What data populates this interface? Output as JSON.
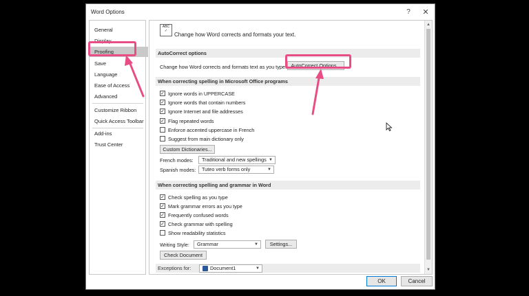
{
  "window": {
    "title": "Word Options",
    "help": "?",
    "close": "✕"
  },
  "sidebar": {
    "items": [
      {
        "label": "General"
      },
      {
        "label": "Display"
      },
      {
        "label": "Proofing"
      },
      {
        "label": "Save"
      },
      {
        "label": "Language"
      },
      {
        "label": "Ease of Access"
      },
      {
        "label": "Advanced"
      },
      {
        "label": "Customize Ribbon"
      },
      {
        "label": "Quick Access Toolbar"
      },
      {
        "label": "Add-ins"
      },
      {
        "label": "Trust Center"
      }
    ]
  },
  "header": {
    "text": "Change how Word corrects and formats your text.",
    "icon": "abc-spellcheck-icon",
    "icon_text": "ABC"
  },
  "autocorrect": {
    "section_title": "AutoCorrect options",
    "desc": "Change how Word corrects and formats text as you type:",
    "button": "AutoCorrect Options..."
  },
  "office_spelling": {
    "section_title": "When correcting spelling in Microsoft Office programs",
    "options": [
      {
        "label": "Ignore words in UPPERCASE",
        "checked": true
      },
      {
        "label": "Ignore words that contain numbers",
        "checked": true
      },
      {
        "label": "Ignore Internet and file addresses",
        "checked": true
      },
      {
        "label": "Flag repeated words",
        "checked": true
      },
      {
        "label": "Enforce accented uppercase in French",
        "checked": false
      },
      {
        "label": "Suggest from main dictionary only",
        "checked": false
      }
    ],
    "dictionaries_button": "Custom Dictionaries...",
    "french_label": "French modes:",
    "french_value": "Traditional and new spellings",
    "spanish_label": "Spanish modes:",
    "spanish_value": "Tuteo verb forms only"
  },
  "word_spelling": {
    "section_title": "When correcting spelling and grammar in Word",
    "options": [
      {
        "label": "Check spelling as you type",
        "checked": true
      },
      {
        "label": "Mark grammar errors as you type",
        "checked": true
      },
      {
        "label": "Frequently confused words",
        "checked": true
      },
      {
        "label": "Check grammar with spelling",
        "checked": true
      },
      {
        "label": "Show readability statistics",
        "checked": false
      }
    ],
    "writing_style_label": "Writing Style:",
    "writing_style_value": "Grammar",
    "settings_button": "Settings...",
    "check_document_button": "Check Document"
  },
  "exceptions": {
    "label": "Exceptions for:",
    "value": "Document1"
  },
  "footer": {
    "ok": "OK",
    "cancel": "Cancel"
  },
  "check_mark": "✓",
  "dropdown_glyph": "▼",
  "colors": {
    "highlight": "#e84d85",
    "accent": "#0078d7",
    "word_blue": "#2b579a"
  }
}
